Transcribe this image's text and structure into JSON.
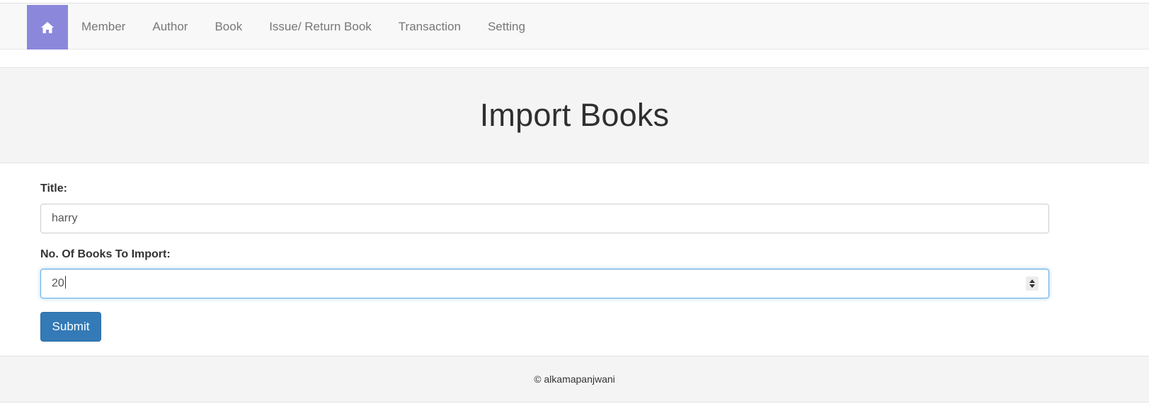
{
  "nav": {
    "home_icon": "home-icon",
    "items": [
      {
        "label": "Member"
      },
      {
        "label": "Author"
      },
      {
        "label": "Book"
      },
      {
        "label": "Issue/ Return Book"
      },
      {
        "label": "Transaction"
      },
      {
        "label": "Setting"
      }
    ],
    "home_color": "#8b88dc"
  },
  "page": {
    "heading": "Import Books"
  },
  "form": {
    "title_label": "Title:",
    "title_value": "harry",
    "count_label": "No. Of Books To Import:",
    "count_value": "20",
    "spinner_icon": "spinner-arrows-icon",
    "submit_label": "Submit",
    "submit_color": "#337ab7"
  },
  "footer": {
    "text": "© alkamapanjwani"
  }
}
